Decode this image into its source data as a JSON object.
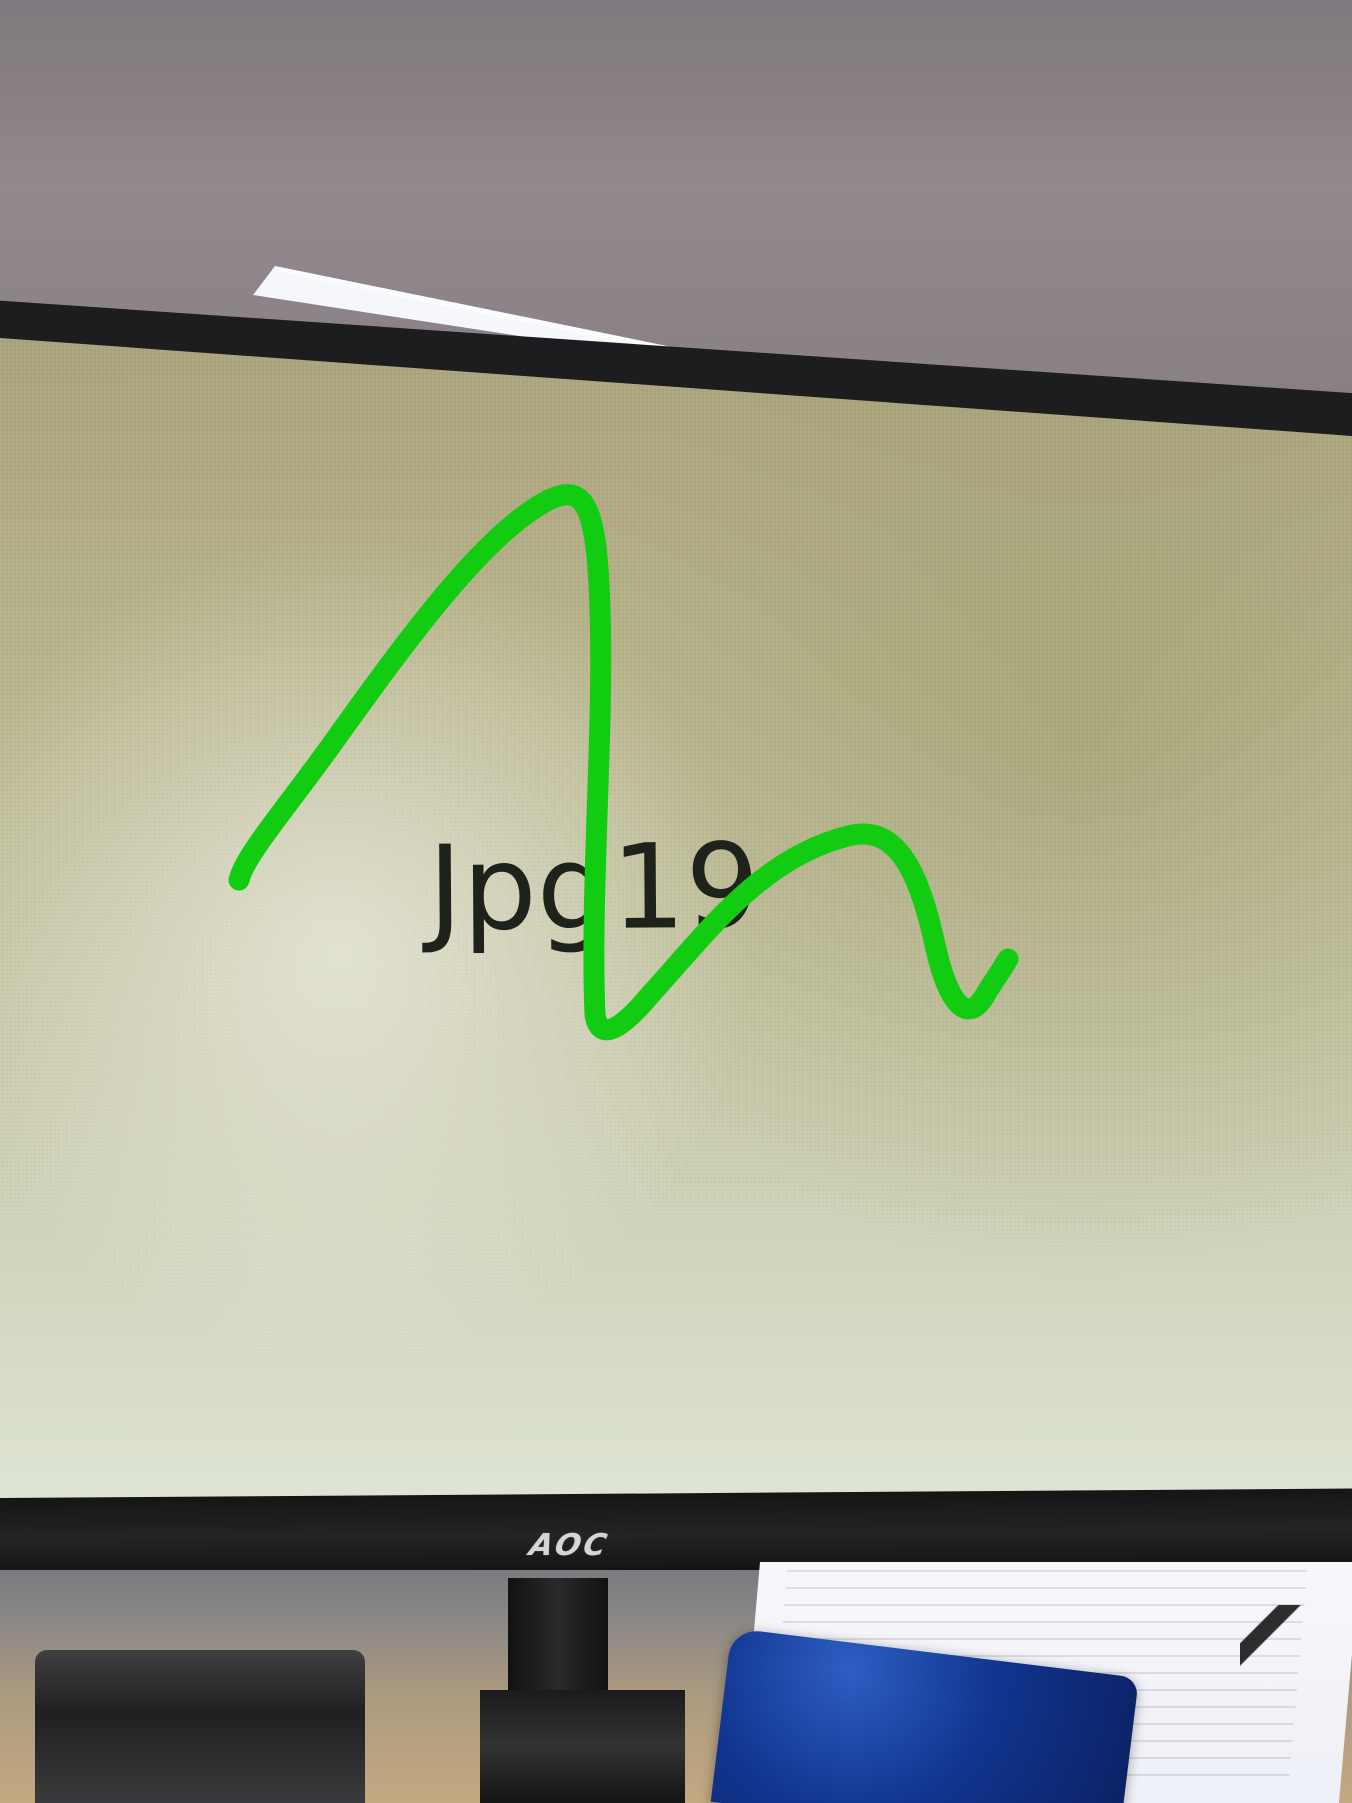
{
  "screen": {
    "text": "Jpg19"
  },
  "monitor": {
    "brand": "AOC"
  },
  "colors": {
    "annotation_stroke": "#11cc11",
    "screen_text": "#1f211b",
    "bezel": "#1d1d1f",
    "logo": "#d5d5d7"
  },
  "icons": {
    "handwritten_mark": "green-freehand-stroke-icon"
  }
}
